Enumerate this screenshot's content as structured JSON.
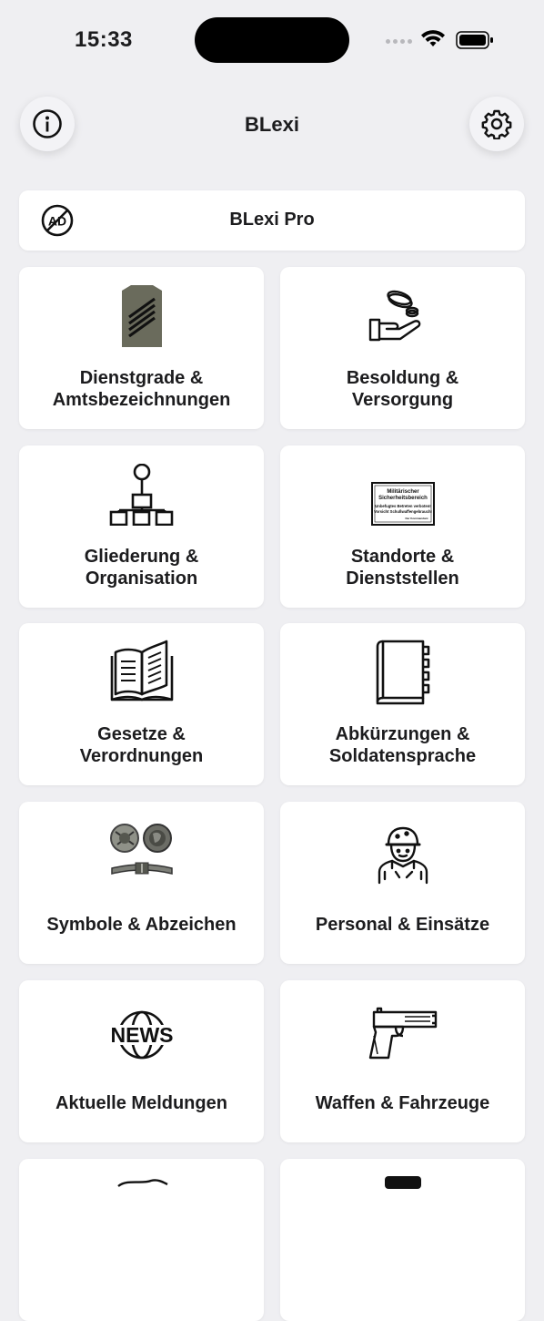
{
  "status": {
    "time": "15:33"
  },
  "nav": {
    "title": "BLexi",
    "info_icon": "info-icon",
    "settings_icon": "gear-icon"
  },
  "pro": {
    "label": "BLexi Pro",
    "icon": "no-ads-icon",
    "icon_text": "AD"
  },
  "tiles": [
    {
      "label": "Dienstgrade &\nAmtsbezeichnungen",
      "icon": "rank-insignia-icon"
    },
    {
      "label": "Besoldung &\nVersorgung",
      "icon": "hand-coins-icon"
    },
    {
      "label": "Gliederung &\nOrganisation",
      "icon": "org-chart-icon"
    },
    {
      "label": "Standorte &\nDienststellen",
      "icon": "restricted-area-sign-icon",
      "sign_lines": [
        "Militärischer",
        "Sicherheitsbereich",
        "Unbefugtes Betreten verboten!",
        "Vorsicht Schußwaffengebrauch!",
        "Der Kommandant"
      ]
    },
    {
      "label": "Gesetze &\nVerordnungen",
      "icon": "open-book-icon"
    },
    {
      "label": "Abkürzungen &\nSoldatensprache",
      "icon": "address-book-icon"
    },
    {
      "label": "Symbole & Abzeichen",
      "icon": "badges-icon"
    },
    {
      "label": "Personal & Einsätze",
      "icon": "soldier-icon"
    },
    {
      "label": "Aktuelle Meldungen",
      "icon": "news-globe-icon",
      "icon_text": "NEWS"
    },
    {
      "label": "Waffen & Fahrzeuge",
      "icon": "pistol-icon"
    }
  ]
}
